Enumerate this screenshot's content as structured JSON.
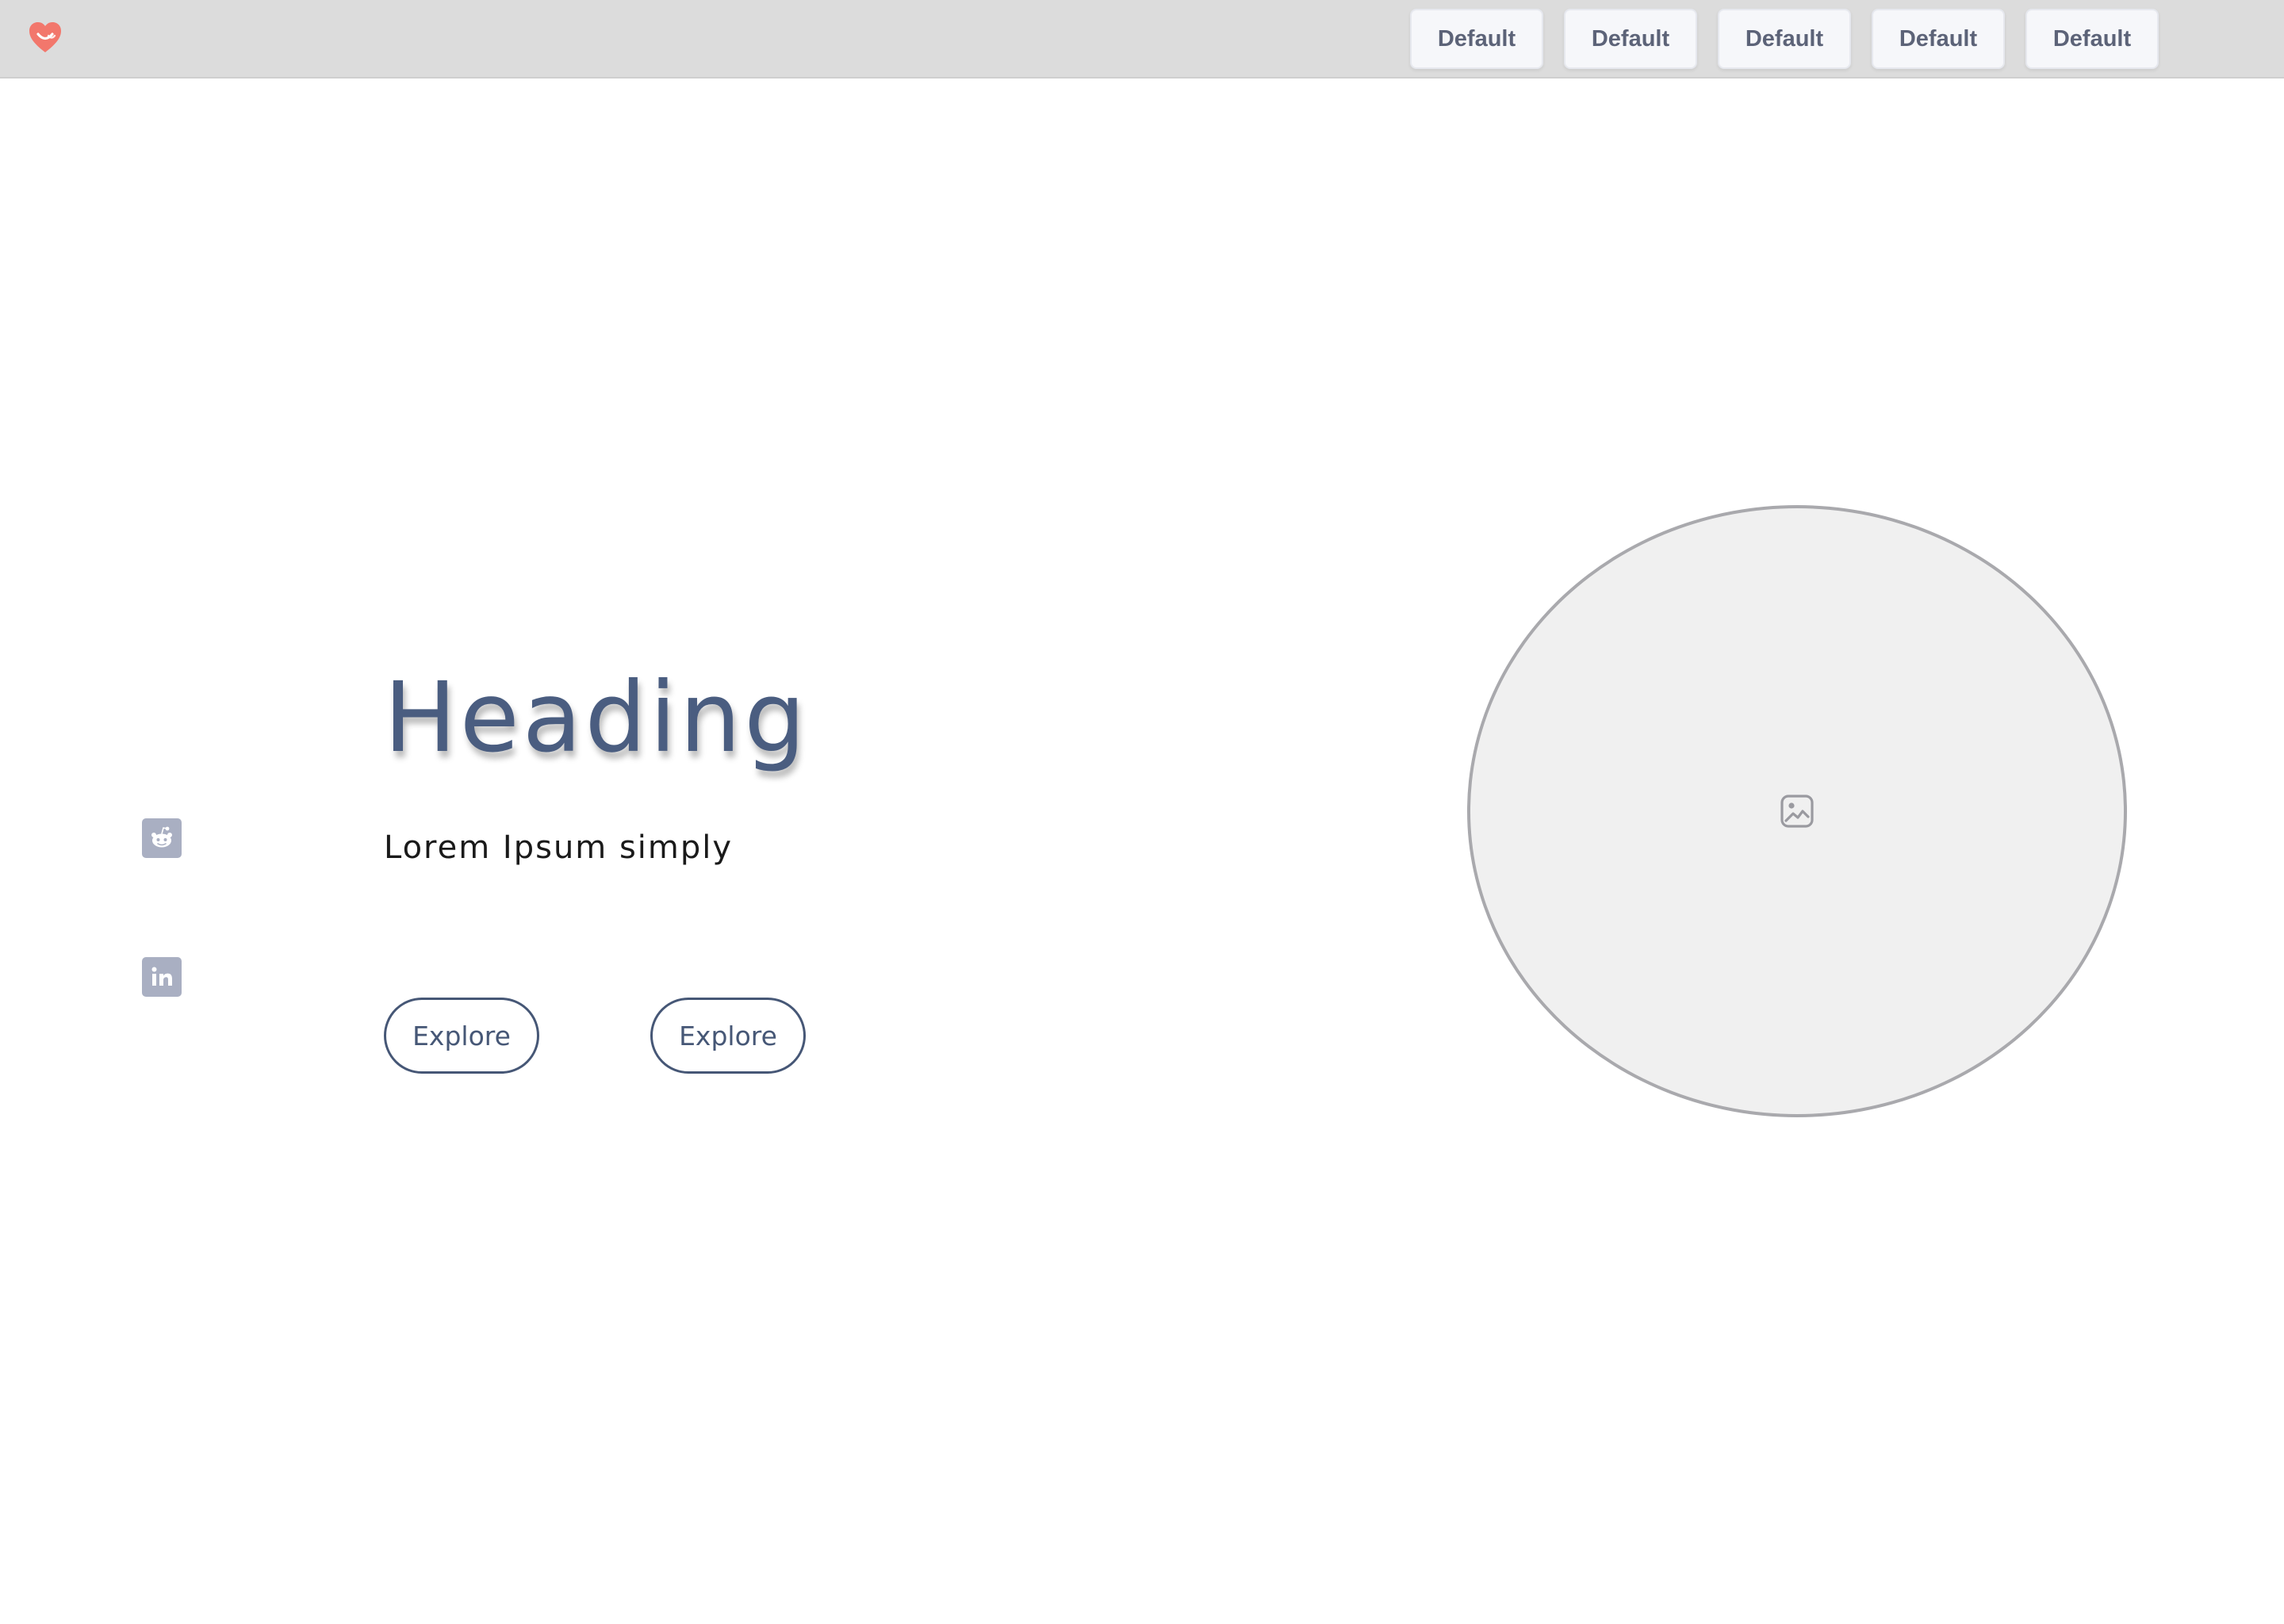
{
  "header": {
    "logo_icon": "heart-smile-icon",
    "nav_buttons": [
      {
        "label": "Default"
      },
      {
        "label": "Default"
      },
      {
        "label": "Default"
      },
      {
        "label": "Default"
      },
      {
        "label": "Default"
      }
    ]
  },
  "social": {
    "items": [
      {
        "icon": "reddit-icon"
      },
      {
        "icon": "linkedin-icon"
      }
    ]
  },
  "hero": {
    "heading": "Heading",
    "subtitle": "Lorem Ipsum simply",
    "buttons": [
      {
        "label": "Explore"
      },
      {
        "label": "Explore"
      }
    ]
  },
  "media": {
    "placeholder_icon": "image-icon"
  },
  "colors": {
    "topbar": "#dcdcdc",
    "heading": "#4a5d80",
    "button_border": "#465776",
    "logo": "#f2776c",
    "social_icon_bg": "#a9afc2",
    "placeholder_bg": "#f0f0f0"
  }
}
